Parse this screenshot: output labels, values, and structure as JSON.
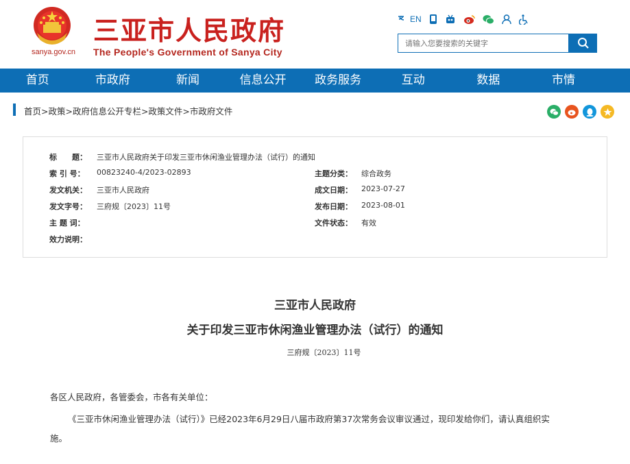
{
  "header": {
    "site_url": "sanya.gov.cn",
    "title_cn": "三亚市人民政府",
    "title_en": "The People's Government of Sanya City",
    "lang_label": "EN",
    "search_placeholder": "请输入您要搜索的关键字"
  },
  "nav": [
    "首页",
    "市政府",
    "新闻",
    "信息公开",
    "政务服务",
    "互动",
    "数据",
    "市情"
  ],
  "breadcrumb": "首页>政策>政府信息公开专栏>政策文件>市政府文件",
  "info": {
    "title_label": "标　　题：",
    "title_value": "三亚市人民政府关于印发三亚市休闲渔业管理办法（试行）的通知",
    "index_label": "索 引 号：",
    "index_value": "00823240-4/2023-02893",
    "topic_label": "主题分类：",
    "topic_value": "综合政务",
    "issuer_label": "发文机关：",
    "issuer_value": "三亚市人民政府",
    "created_label": "成文日期：",
    "created_value": "2023-07-27",
    "docno_label": "发文字号：",
    "docno_value": "三府规〔2023〕11号",
    "published_label": "发布日期：",
    "published_value": "2023-08-01",
    "keywords_label": "主 题 词：",
    "status_label": "文件状态：",
    "status_value": "有效",
    "validity_label": "效力说明："
  },
  "article": {
    "heading1": "三亚市人民政府",
    "heading2": "关于印发三亚市休闲渔业管理办法（试行）的通知",
    "doc_no": "三府规〔2023〕11号",
    "greeting": "各区人民政府，各管委会，市各有关单位：",
    "body_line1": "《三亚市休闲渔业管理办法（试行）》已经2023年6月29日八届市政府第37次常务会议审议通过，现印发给你们，请认真组织实",
    "body_line2": "施。"
  },
  "colors": {
    "brand_red": "#c9211e",
    "nav_blue": "#0d6eb5"
  }
}
